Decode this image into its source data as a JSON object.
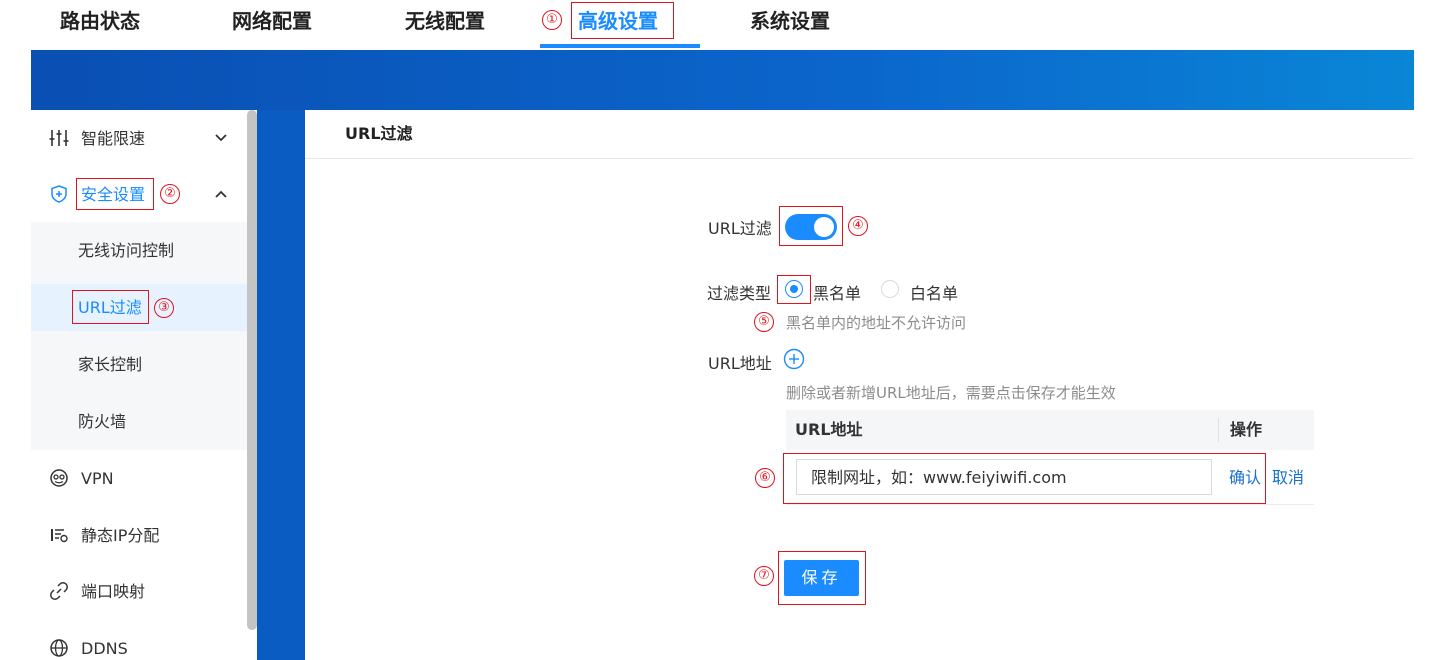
{
  "topnav": {
    "items": [
      {
        "label": "路由状态"
      },
      {
        "label": "网络配置"
      },
      {
        "label": "无线配置"
      },
      {
        "label": "高级设置"
      },
      {
        "label": "系统设置"
      }
    ],
    "active_index": 3
  },
  "annotations": [
    "①",
    "②",
    "③",
    "④",
    "⑤",
    "⑥",
    "⑦"
  ],
  "sidebar": {
    "items": [
      {
        "label": "智能限速",
        "icon": "sliders-icon",
        "expanded": false
      },
      {
        "label": "安全设置",
        "icon": "shield-plus-icon",
        "expanded": true
      },
      {
        "label": "VPN",
        "icon": "vpn-icon"
      },
      {
        "label": "静态IP分配",
        "icon": "ip-list-icon"
      },
      {
        "label": "端口映射",
        "icon": "link-icon"
      },
      {
        "label": "DDNS",
        "icon": "globe-icon"
      }
    ],
    "sub_items": [
      {
        "label": "无线访问控制"
      },
      {
        "label": "URL过滤",
        "active": true
      },
      {
        "label": "家长控制"
      },
      {
        "label": "防火墙"
      }
    ]
  },
  "main": {
    "title": "URL过滤",
    "filter_toggle": {
      "label": "URL过滤",
      "on": true
    },
    "filter_type": {
      "label": "过滤类型",
      "options": [
        {
          "label": "黑名单",
          "checked": true
        },
        {
          "label": "白名单",
          "checked": false
        }
      ],
      "hint": "黑名单内的地址不允许访问"
    },
    "url_address": {
      "label": "URL地址",
      "hint": "删除或者新增URL地址后，需要点击保存才能生效"
    },
    "table": {
      "headers": [
        "URL地址",
        "操作"
      ],
      "input_placeholder": "限制网址，如：www.feiyiwifi.com",
      "confirm_label": "确认",
      "cancel_label": "取消"
    },
    "save_label": "保存"
  },
  "colors": {
    "accent": "#1a8cff",
    "annotation": "#e0141e",
    "banner": "#0b66cc"
  }
}
